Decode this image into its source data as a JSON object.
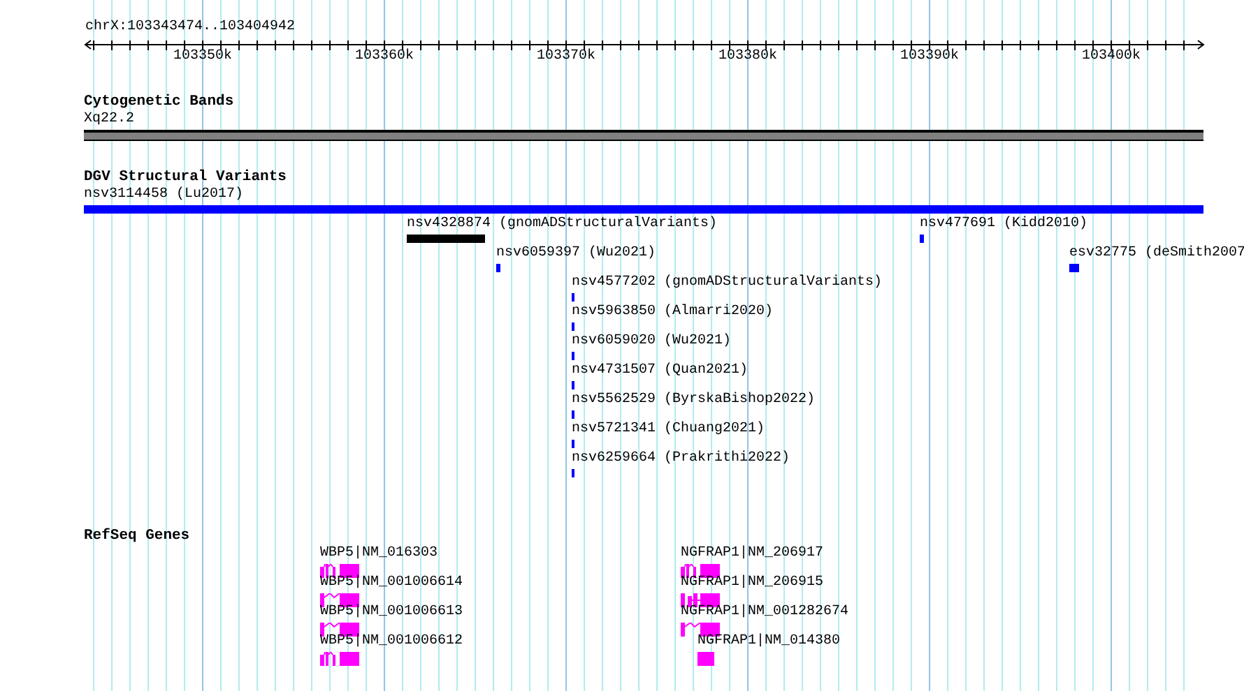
{
  "ruler": {
    "label": "chrX:103343474..103404942",
    "ticks": [
      "103350k",
      "103360k",
      "103370k",
      "103380k",
      "103390k",
      "103400k"
    ]
  },
  "tracks": [
    {
      "kind": "band",
      "title": "Cytogenetic Bands",
      "features": [
        {
          "label": "Xq22.2",
          "color": "#808080"
        }
      ]
    },
    {
      "kind": "variant",
      "title": "DGV Structural Variants",
      "features": [
        {
          "label": "nsv3114458 (Lu2017)",
          "color": "#0000ff"
        },
        {
          "label": "nsv4328874 (gnomADStructuralVariants)",
          "color": "#000000"
        },
        {
          "label": "nsv6059397 (Wu2021)",
          "color": "#0000ff"
        },
        {
          "label": "nsv4577202 (gnomADStructuralVariants)",
          "color": "#0000ff"
        },
        {
          "label": "nsv5963850 (Almarri2020)",
          "color": "#0000ff"
        },
        {
          "label": "nsv6059020 (Wu2021)",
          "color": "#0000ff"
        },
        {
          "label": "nsv4731507 (Quan2021)",
          "color": "#0000ff"
        },
        {
          "label": "nsv5562529 (ByrskaBishop2022)",
          "color": "#0000ff"
        },
        {
          "label": "nsv5721341 (Chuang2021)",
          "color": "#0000ff"
        },
        {
          "label": "nsv6259664 (Prakrithi2022)",
          "color": "#0000ff"
        },
        {
          "label": "nsv477691 (Kidd2010)",
          "color": "#0000ff"
        },
        {
          "label": "esv32775 (deSmith2007",
          "color": "#0000ff"
        }
      ]
    },
    {
      "kind": "gene",
      "title": "RefSeq Genes",
      "features": [
        {
          "label": "WBP5|NM_016303",
          "color": "#ff00ff"
        },
        {
          "label": "WBP5|NM_001006614",
          "color": "#ff00ff"
        },
        {
          "label": "WBP5|NM_001006613",
          "color": "#ff00ff"
        },
        {
          "label": "WBP5|NM_001006612",
          "color": "#ff00ff"
        },
        {
          "label": "NGFRAP1|NM_206917",
          "color": "#ff00ff"
        },
        {
          "label": "NGFRAP1|NM_206915",
          "color": "#ff00ff"
        },
        {
          "label": "NGFRAP1|NM_001282674",
          "color": "#ff00ff"
        },
        {
          "label": "NGFRAP1|NM_014380",
          "color": "#ff00ff"
        }
      ]
    }
  ]
}
